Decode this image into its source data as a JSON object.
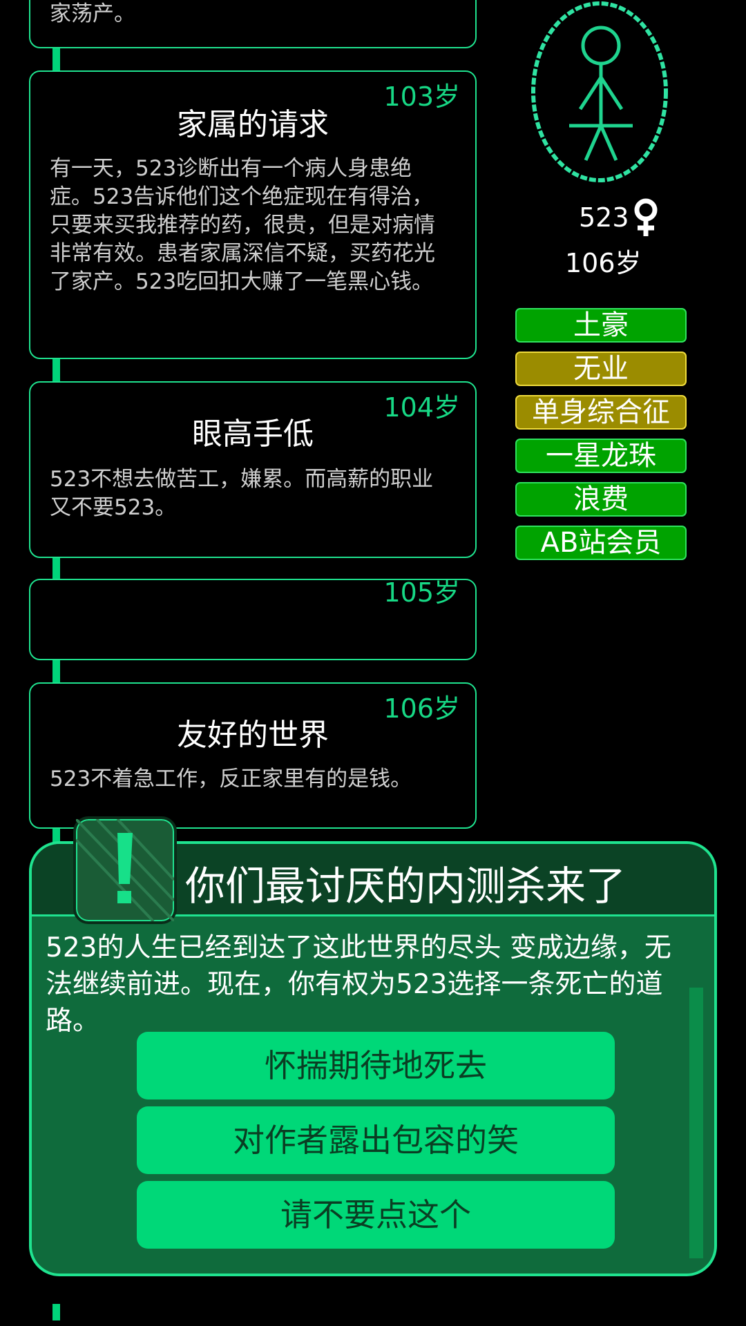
{
  "timeline": {
    "top_card_text": "家荡产。",
    "events": [
      {
        "age": "103岁",
        "title": "家属的请求",
        "text": "有一天，523诊断出有一个病人身患绝症。523告诉他们这个绝症现在有得治，只要来买我推荐的药，很贵，但是对病情非常有效。患者家属深信不疑，买药花光了家产。523吃回扣大赚了一笔黑心钱。"
      },
      {
        "age": "104岁",
        "title": "眼高手低",
        "text": "523不想去做苦工，嫌累。而高薪的职业又不要523。"
      },
      {
        "age": "105岁",
        "title": "",
        "text": ""
      },
      {
        "age": "106岁",
        "title": "友好的世界",
        "text": "523不着急工作，反正家里有的是钱。"
      }
    ]
  },
  "character": {
    "name": "523",
    "gender": "female",
    "gender_icon": "female-symbol-icon",
    "age": "106岁",
    "tags": [
      {
        "label": "土豪",
        "color": "#00a300"
      },
      {
        "label": "无业",
        "color": "#9b8c00"
      },
      {
        "label": "单身综合征",
        "color": "#9b8c00"
      },
      {
        "label": "一星龙珠",
        "color": "#00a300"
      },
      {
        "label": "浪费",
        "color": "#00a300"
      },
      {
        "label": "AB站会员",
        "color": "#00a300"
      }
    ]
  },
  "dialog": {
    "title": "你们最讨厌的内测杀来了",
    "icon": "exclamation-icon",
    "text": "523的人生已经到达了这此世界的尽头 变成边缘，无法继续前进。现在，你有权为523选择一条死亡的道路。",
    "choices": [
      "怀揣期待地死去",
      "对作者露出包容的笑",
      "请不要点这个"
    ]
  },
  "colors": {
    "accent": "#1fe38f",
    "button": "#00d878",
    "panel": "#0f6b3c"
  }
}
